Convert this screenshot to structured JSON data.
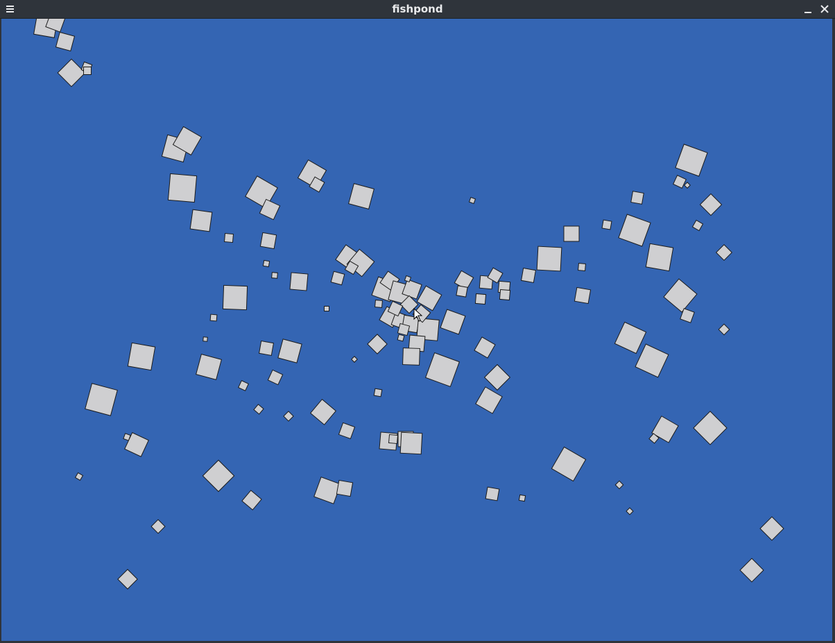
{
  "window": {
    "title": "fishpond",
    "menu_icon": "hamburger-menu-icon",
    "minimize_icon": "minimize-icon",
    "close_icon": "close-icon"
  },
  "colors": {
    "titlebar": "#2f343b",
    "title_text": "#e9eaec",
    "pond": "#3465b3",
    "fish_fill": "#cfcfd1",
    "fish_stroke": "#1c1c1c"
  }
}
